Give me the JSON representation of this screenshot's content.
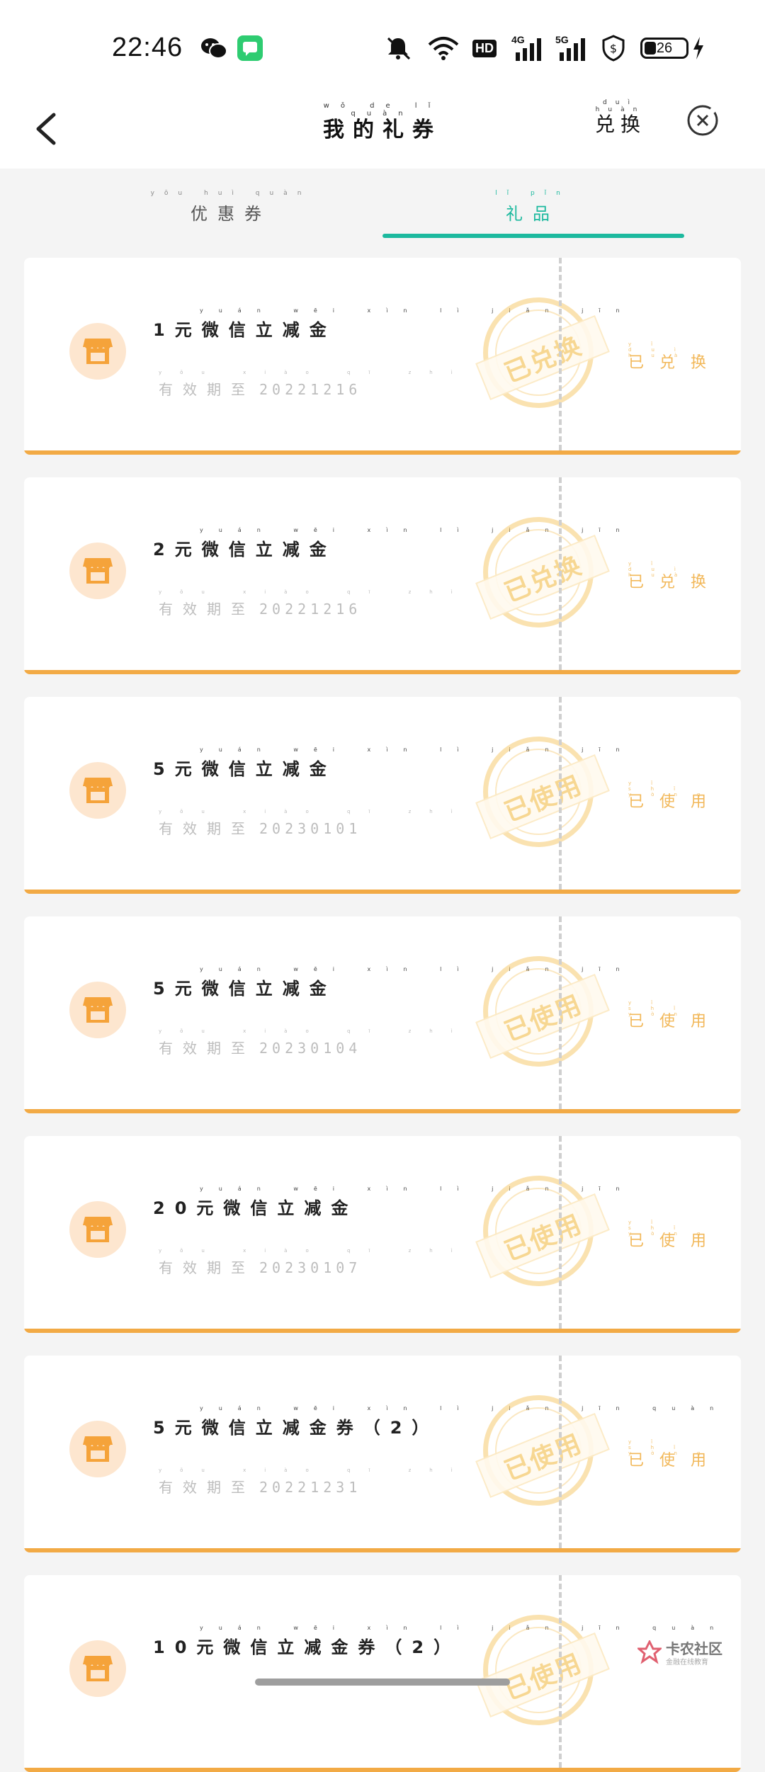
{
  "status_bar": {
    "time": "22:46",
    "network_labels": [
      "HD",
      "4G",
      "5G"
    ],
    "battery": "26",
    "icons": [
      "wechat-icon",
      "message-app-icon",
      "mute-icon",
      "wifi-icon",
      "hd-icon",
      "4g-signal-icon",
      "5g-signal-icon",
      "shield-dollar-icon",
      "battery-icon",
      "charging-icon"
    ]
  },
  "app_bar": {
    "title_pinyin": "wǒ de lǐ quàn",
    "title": "我的礼券",
    "exchange_pinyin": "duì huàn",
    "exchange_label": "兑换"
  },
  "tabs": [
    {
      "pinyin": "yōu huì quàn",
      "label": "优惠券",
      "active": false
    },
    {
      "pinyin": "lǐ pǐn",
      "label": "礼品",
      "active": true
    }
  ],
  "coupons": [
    {
      "title_pinyin": "yuán wēi xìn lì jiǎn jīn",
      "title": "1元微信立减金",
      "valid_pinyin": "yǒu xiào qī zhì",
      "valid_label": "有效期至",
      "date": "20221216",
      "stamp": "已兑换",
      "status_pinyin": "yǐ duì huàn",
      "status": "已兑换"
    },
    {
      "title_pinyin": "yuán wēi xìn lì jiǎn jīn",
      "title": "2元微信立减金",
      "valid_pinyin": "yǒu xiào qī zhì",
      "valid_label": "有效期至",
      "date": "20221216",
      "stamp": "已兑换",
      "status_pinyin": "yǐ duì huàn",
      "status": "已兑换"
    },
    {
      "title_pinyin": "yuán wēi xìn lì jiǎn jīn",
      "title": "5元微信立减金",
      "valid_pinyin": "yǒu xiào qī zhì",
      "valid_label": "有效期至",
      "date": "20230101",
      "stamp": "已使用",
      "status_pinyin": "yǐ shǐ yòng",
      "status": "已使用"
    },
    {
      "title_pinyin": "yuán wēi xìn lì jiǎn jīn",
      "title": "5元微信立减金",
      "valid_pinyin": "yǒu xiào qī zhì",
      "valid_label": "有效期至",
      "date": "20230104",
      "stamp": "已使用",
      "status_pinyin": "yǐ shǐ yòng",
      "status": "已使用"
    },
    {
      "title_pinyin": "yuán wēi xìn lì jiǎn jīn",
      "title": "20元微信立减金",
      "valid_pinyin": "yǒu xiào qī zhì",
      "valid_label": "有效期至",
      "date": "20230107",
      "stamp": "已使用",
      "status_pinyin": "yǐ shǐ yòng",
      "status": "已使用"
    },
    {
      "title_pinyin": "yuán wēi xìn lì jiǎn jīn quàn",
      "title": "5元微信立减金券（2）",
      "valid_pinyin": "yǒu xiào qī zhì",
      "valid_label": "有效期至",
      "date": "20221231",
      "stamp": "已使用",
      "status_pinyin": "yǐ shǐ yòng",
      "status": "已使用"
    },
    {
      "title_pinyin": "yuán wēi xìn lì jiǎn jīn quàn",
      "title": "10元微信立减金券（2）",
      "valid_pinyin": "",
      "valid_label": "",
      "date": "",
      "stamp": "已使用",
      "status_pinyin": "",
      "status": ""
    }
  ],
  "watermark": {
    "name": "卡农社区",
    "subtitle": "金融在线教育"
  },
  "colors": {
    "accent": "#1cb99e",
    "orange": "#f2aa45",
    "stamp": "#f2c06a",
    "background": "#f4f4f4"
  }
}
